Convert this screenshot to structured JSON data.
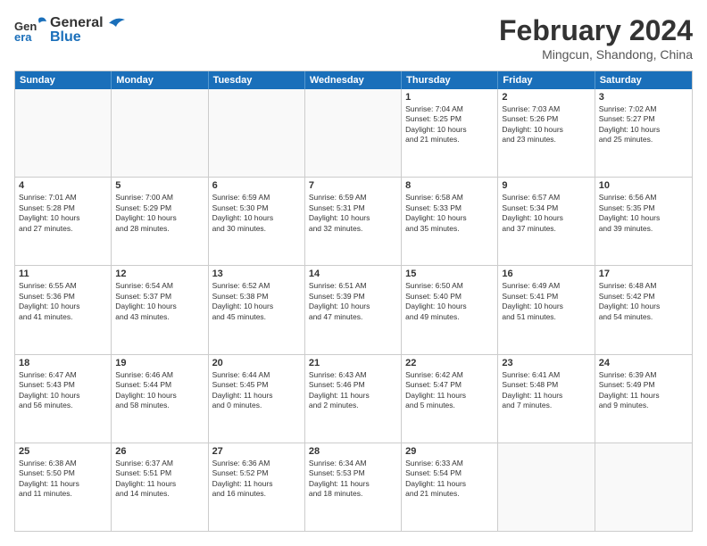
{
  "header": {
    "logo_line1": "General",
    "logo_line2": "Blue",
    "month_title": "February 2024",
    "location": "Mingcun, Shandong, China"
  },
  "days_of_week": [
    "Sunday",
    "Monday",
    "Tuesday",
    "Wednesday",
    "Thursday",
    "Friday",
    "Saturday"
  ],
  "rows": [
    [
      {
        "day": "",
        "info": "",
        "empty": true
      },
      {
        "day": "",
        "info": "",
        "empty": true
      },
      {
        "day": "",
        "info": "",
        "empty": true
      },
      {
        "day": "",
        "info": "",
        "empty": true
      },
      {
        "day": "1",
        "info": "Sunrise: 7:04 AM\nSunset: 5:25 PM\nDaylight: 10 hours\nand 21 minutes."
      },
      {
        "day": "2",
        "info": "Sunrise: 7:03 AM\nSunset: 5:26 PM\nDaylight: 10 hours\nand 23 minutes."
      },
      {
        "day": "3",
        "info": "Sunrise: 7:02 AM\nSunset: 5:27 PM\nDaylight: 10 hours\nand 25 minutes."
      }
    ],
    [
      {
        "day": "4",
        "info": "Sunrise: 7:01 AM\nSunset: 5:28 PM\nDaylight: 10 hours\nand 27 minutes."
      },
      {
        "day": "5",
        "info": "Sunrise: 7:00 AM\nSunset: 5:29 PM\nDaylight: 10 hours\nand 28 minutes."
      },
      {
        "day": "6",
        "info": "Sunrise: 6:59 AM\nSunset: 5:30 PM\nDaylight: 10 hours\nand 30 minutes."
      },
      {
        "day": "7",
        "info": "Sunrise: 6:59 AM\nSunset: 5:31 PM\nDaylight: 10 hours\nand 32 minutes."
      },
      {
        "day": "8",
        "info": "Sunrise: 6:58 AM\nSunset: 5:33 PM\nDaylight: 10 hours\nand 35 minutes."
      },
      {
        "day": "9",
        "info": "Sunrise: 6:57 AM\nSunset: 5:34 PM\nDaylight: 10 hours\nand 37 minutes."
      },
      {
        "day": "10",
        "info": "Sunrise: 6:56 AM\nSunset: 5:35 PM\nDaylight: 10 hours\nand 39 minutes."
      }
    ],
    [
      {
        "day": "11",
        "info": "Sunrise: 6:55 AM\nSunset: 5:36 PM\nDaylight: 10 hours\nand 41 minutes."
      },
      {
        "day": "12",
        "info": "Sunrise: 6:54 AM\nSunset: 5:37 PM\nDaylight: 10 hours\nand 43 minutes."
      },
      {
        "day": "13",
        "info": "Sunrise: 6:52 AM\nSunset: 5:38 PM\nDaylight: 10 hours\nand 45 minutes."
      },
      {
        "day": "14",
        "info": "Sunrise: 6:51 AM\nSunset: 5:39 PM\nDaylight: 10 hours\nand 47 minutes."
      },
      {
        "day": "15",
        "info": "Sunrise: 6:50 AM\nSunset: 5:40 PM\nDaylight: 10 hours\nand 49 minutes."
      },
      {
        "day": "16",
        "info": "Sunrise: 6:49 AM\nSunset: 5:41 PM\nDaylight: 10 hours\nand 51 minutes."
      },
      {
        "day": "17",
        "info": "Sunrise: 6:48 AM\nSunset: 5:42 PM\nDaylight: 10 hours\nand 54 minutes."
      }
    ],
    [
      {
        "day": "18",
        "info": "Sunrise: 6:47 AM\nSunset: 5:43 PM\nDaylight: 10 hours\nand 56 minutes."
      },
      {
        "day": "19",
        "info": "Sunrise: 6:46 AM\nSunset: 5:44 PM\nDaylight: 10 hours\nand 58 minutes."
      },
      {
        "day": "20",
        "info": "Sunrise: 6:44 AM\nSunset: 5:45 PM\nDaylight: 11 hours\nand 0 minutes."
      },
      {
        "day": "21",
        "info": "Sunrise: 6:43 AM\nSunset: 5:46 PM\nDaylight: 11 hours\nand 2 minutes."
      },
      {
        "day": "22",
        "info": "Sunrise: 6:42 AM\nSunset: 5:47 PM\nDaylight: 11 hours\nand 5 minutes."
      },
      {
        "day": "23",
        "info": "Sunrise: 6:41 AM\nSunset: 5:48 PM\nDaylight: 11 hours\nand 7 minutes."
      },
      {
        "day": "24",
        "info": "Sunrise: 6:39 AM\nSunset: 5:49 PM\nDaylight: 11 hours\nand 9 minutes."
      }
    ],
    [
      {
        "day": "25",
        "info": "Sunrise: 6:38 AM\nSunset: 5:50 PM\nDaylight: 11 hours\nand 11 minutes."
      },
      {
        "day": "26",
        "info": "Sunrise: 6:37 AM\nSunset: 5:51 PM\nDaylight: 11 hours\nand 14 minutes."
      },
      {
        "day": "27",
        "info": "Sunrise: 6:36 AM\nSunset: 5:52 PM\nDaylight: 11 hours\nand 16 minutes."
      },
      {
        "day": "28",
        "info": "Sunrise: 6:34 AM\nSunset: 5:53 PM\nDaylight: 11 hours\nand 18 minutes."
      },
      {
        "day": "29",
        "info": "Sunrise: 6:33 AM\nSunset: 5:54 PM\nDaylight: 11 hours\nand 21 minutes."
      },
      {
        "day": "",
        "info": "",
        "empty": true
      },
      {
        "day": "",
        "info": "",
        "empty": true
      }
    ]
  ]
}
